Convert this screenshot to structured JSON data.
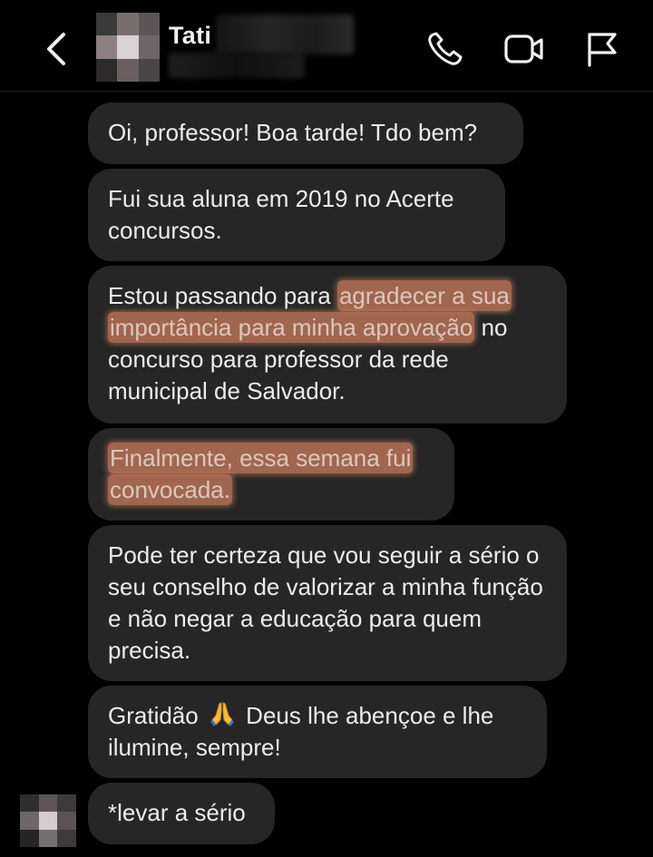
{
  "header": {
    "contact_name": "Tati",
    "icons": [
      "back-icon",
      "phone-icon",
      "video-camera-icon",
      "flag-icon"
    ]
  },
  "messages": [
    {
      "parts": [
        {
          "text": "Oi, professor! Boa tarde! Tdo bem?",
          "highlight": false
        }
      ]
    },
    {
      "parts": [
        {
          "text": "Fui sua aluna em 2019 no Acerte concursos.",
          "highlight": false
        }
      ]
    },
    {
      "parts": [
        {
          "text": "Estou passando para ",
          "highlight": false
        },
        {
          "text": "agradecer a sua importância para minha aprovação",
          "highlight": true
        },
        {
          "text": " no concurso para professor da rede municipal de Salvador.",
          "highlight": false
        }
      ]
    },
    {
      "parts": [
        {
          "text": "Finalmente, essa semana fui convocada.",
          "highlight": true
        }
      ]
    },
    {
      "parts": [
        {
          "text": "Pode ter certeza que vou seguir a sério o seu conselho de valorizar a minha função e não negar a educação para quem precisa.",
          "highlight": false
        }
      ]
    },
    {
      "parts": [
        {
          "text": "Gratidão ",
          "highlight": false
        },
        {
          "text": "🙏",
          "highlight": false,
          "emoji": "folded-hands"
        },
        {
          "text": " Deus lhe abençoe e lhe ilumine, sempre!",
          "highlight": false
        }
      ]
    },
    {
      "parts": [
        {
          "text": "*levar a sério",
          "highlight": false
        }
      ]
    }
  ],
  "colors": {
    "background": "#000000",
    "bubble": "#262626",
    "text": "#ececec",
    "highlight": "#d98a68"
  }
}
